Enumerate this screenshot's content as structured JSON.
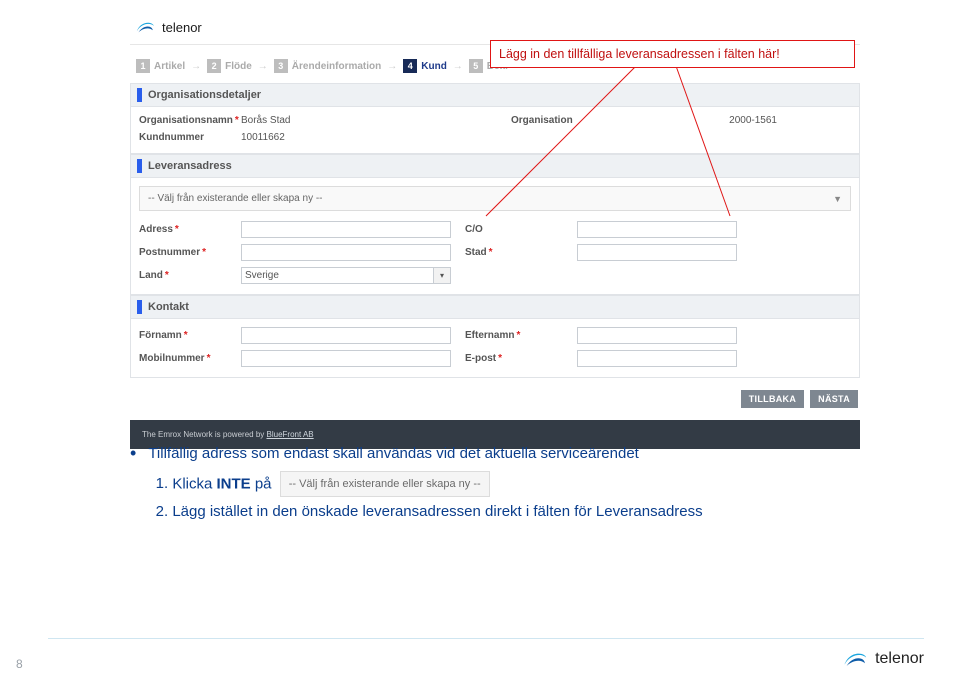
{
  "brand": {
    "name": "telenor"
  },
  "steps": [
    {
      "num": "1",
      "label": "Artikel",
      "active": false
    },
    {
      "num": "2",
      "label": "Flöde",
      "active": false
    },
    {
      "num": "3",
      "label": "Ärendeinformation",
      "active": false
    },
    {
      "num": "4",
      "label": "Kund",
      "active": true
    },
    {
      "num": "5",
      "label": "Bekr",
      "active": false
    }
  ],
  "sections": {
    "org": {
      "title": "Organisationsdetaljer",
      "orgname_label": "Organisationsnamn",
      "orgname_value": "Borås Stad",
      "orgnum_label": "Organisation",
      "orgnum_value": "2000-1561",
      "custnum_label": "Kundnummer",
      "custnum_value": "10011662"
    },
    "delivery": {
      "title": "Leveransadress",
      "select_placeholder": "-- Välj från existerande eller skapa ny --",
      "address_label": "Adress",
      "co_label": "C/O",
      "postal_label": "Postnummer",
      "city_label": "Stad",
      "country_label": "Land",
      "country_value": "Sverige"
    },
    "contact": {
      "title": "Kontakt",
      "firstname_label": "Förnamn",
      "lastname_label": "Efternamn",
      "mobile_label": "Mobilnummer",
      "email_label": "E-post"
    }
  },
  "buttons": {
    "back": "TILLBAKA",
    "next": "NÄSTA"
  },
  "footer": {
    "text_prefix": "The Emrox Network is powered by ",
    "link": "BlueFront AB"
  },
  "callout": {
    "text": "Lägg in den tillfälliga leveransadressen i fälten här!"
  },
  "instructions": {
    "heading": "Tillfällig adress som endast skall användas vid det aktuella serviceärendet",
    "li1_prefix": "Klicka ",
    "li1_emph": "INTE",
    "li1_suffix": " på",
    "li1_chip": "-- Välj från existerande eller skapa ny --",
    "li2": "Lägg istället in den önskade leveransadressen direkt i fälten för Leveransadress"
  },
  "page_number": "8"
}
